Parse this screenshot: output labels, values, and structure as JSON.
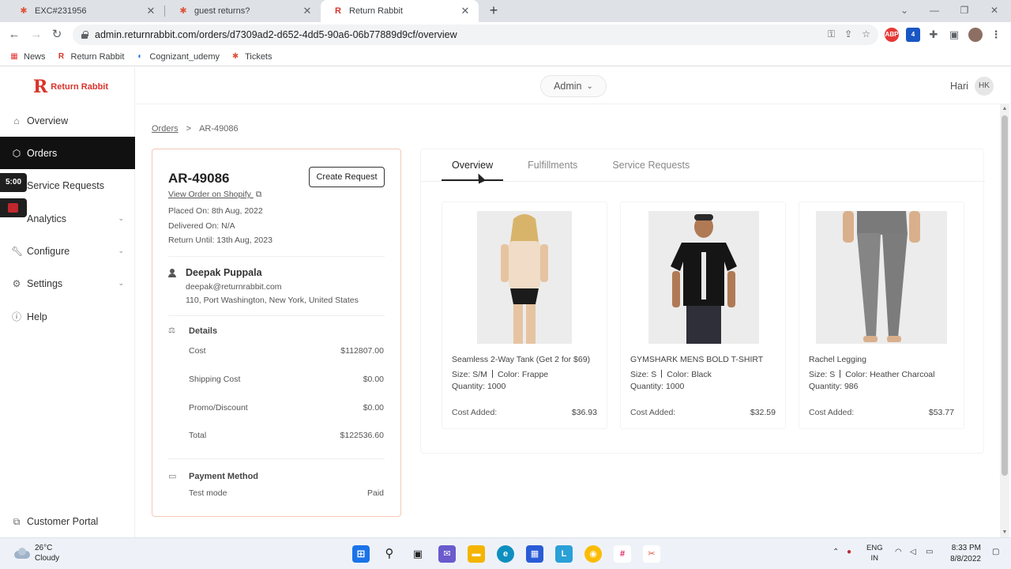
{
  "browser": {
    "tabs": [
      {
        "title": "EXC#231956",
        "active": false
      },
      {
        "title": "guest returns?",
        "active": false
      },
      {
        "title": "Return Rabbit",
        "active": true
      }
    ],
    "url": "admin.returnrabbit.com/orders/d7309ad2-d652-4dd5-90a6-06b77889d9cf/overview",
    "bookmarks": [
      "News",
      "Return Rabbit",
      "Cognizant_udemy",
      "Tickets"
    ]
  },
  "app": {
    "brand": "Return Rabbit",
    "brand_color": "#d9332b",
    "sidebar": {
      "items": [
        {
          "label": "Overview",
          "icon": "home-icon",
          "active": false
        },
        {
          "label": "Orders",
          "icon": "box-icon",
          "active": true
        },
        {
          "label": "Service Requests",
          "icon": "service-icon",
          "active": false
        },
        {
          "label": "Analytics",
          "icon": "chart-icon",
          "active": false,
          "expandable": true
        },
        {
          "label": "Configure",
          "icon": "wrench-icon",
          "active": false,
          "expandable": true
        },
        {
          "label": "Settings",
          "icon": "gear-icon",
          "active": false,
          "expandable": true
        },
        {
          "label": "Help",
          "icon": "help-icon",
          "active": false
        }
      ],
      "footer": "Customer Portal"
    },
    "recorder": {
      "time": "5:00"
    },
    "header": {
      "role_select": "Admin",
      "user_name": "Hari",
      "user_initials": "HK"
    },
    "breadcrumb": {
      "root": "Orders",
      "separator": ">",
      "current": "AR-49086"
    }
  },
  "order": {
    "id": "AR-49086",
    "create_request_label": "Create Request",
    "shopify_link": "View Order on Shopify",
    "placed_on": "Placed On: 8th Aug, 2022",
    "delivered_on": "Delivered On: N/A",
    "return_until": "Return Until: 13th Aug, 2023",
    "customer": {
      "name": "Deepak Puppala",
      "email": "deepak@returnrabbit.com",
      "address": "110, Port Washington, New York, United States"
    },
    "details": {
      "title": "Details",
      "rows": [
        {
          "label": "Cost",
          "value": "$112807.00"
        },
        {
          "label": "Shipping Cost",
          "value": "$0.00"
        },
        {
          "label": "Promo/Discount",
          "value": "$0.00"
        },
        {
          "label": "Total",
          "value": "$122536.60"
        }
      ]
    },
    "payment": {
      "title": "Payment Method",
      "label": "Test mode",
      "status": "Paid"
    }
  },
  "panel": {
    "tabs": [
      {
        "label": "Overview",
        "active": true
      },
      {
        "label": "Fulfillments",
        "active": false
      },
      {
        "label": "Service Requests",
        "active": false
      }
    ],
    "products": [
      {
        "name": "Seamless 2-Way Tank (Get 2 for $69)",
        "size": "Size: S/M",
        "color": "Color: Frappe",
        "quantity": "Quantity: 1000",
        "cost_label": "Cost Added:",
        "cost": "$36.93"
      },
      {
        "name": "GYMSHARK MENS BOLD T-SHIRT",
        "size": "Size: S",
        "color": "Color: Black",
        "quantity": "Quantity: 1000",
        "cost_label": "Cost Added:",
        "cost": "$32.59"
      },
      {
        "name": "Rachel Legging",
        "size": "Size: S",
        "color": "Color: Heather Charcoal",
        "quantity": "Quantity: 986",
        "cost_label": "Cost Added:",
        "cost": "$53.77"
      }
    ]
  },
  "taskbar": {
    "temperature": "26°C",
    "weather": "Cloudy",
    "language": "ENG",
    "region": "IN",
    "time": "8:33 PM",
    "date": "8/8/2022"
  }
}
